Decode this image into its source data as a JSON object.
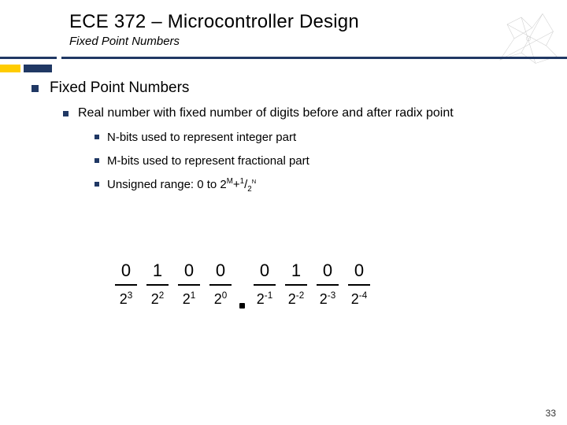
{
  "header": {
    "title": "ECE 372 – Microcontroller Design",
    "subtitle": "Fixed Point Numbers"
  },
  "bullets": {
    "l1": "Fixed Point Numbers",
    "l2": "Real number with fixed number of digits before and after radix point",
    "l3a": "N-bits used to represent integer part",
    "l3b": "M-bits used to represent fractional part",
    "l3c_pre": "Unsigned range: 0 to 2",
    "l3c_sup1": "M",
    "l3c_mid": "+",
    "l3c_sup2": "1",
    "l3c_slash": "/",
    "l3c_sub": "2",
    "l3c_sup3": "N"
  },
  "bits": {
    "int": [
      {
        "top": "0",
        "base": "2",
        "exp": "3"
      },
      {
        "top": "1",
        "base": "2",
        "exp": "2"
      },
      {
        "top": "0",
        "base": "2",
        "exp": "1"
      },
      {
        "top": "0",
        "base": "2",
        "exp": "0"
      }
    ],
    "frac": [
      {
        "top": "0",
        "base": "2",
        "exp": "-1"
      },
      {
        "top": "1",
        "base": "2",
        "exp": "-2"
      },
      {
        "top": "0",
        "base": "2",
        "exp": "-3"
      },
      {
        "top": "0",
        "base": "2",
        "exp": "-4"
      }
    ]
  },
  "page": "33"
}
